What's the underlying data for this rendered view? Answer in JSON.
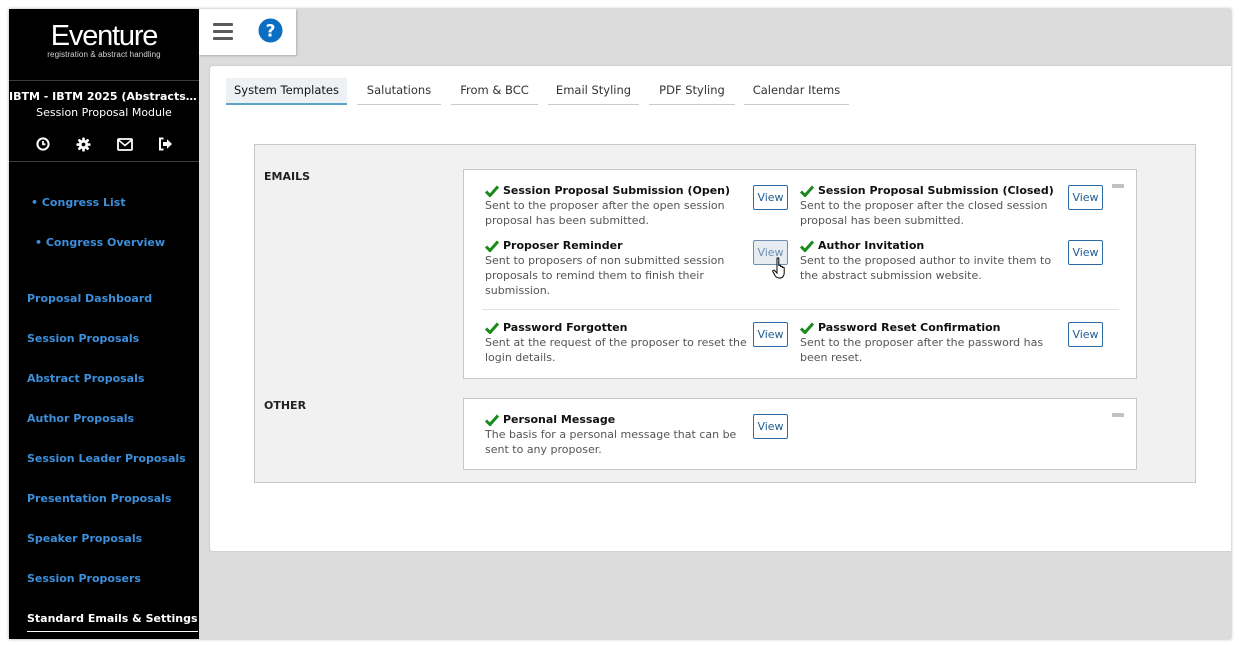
{
  "app": {
    "logo_name": "Eventure",
    "logo_tagline": "registration & abstract handling"
  },
  "event": {
    "title": "IBTM - IBTM 2025 (Abstracts & Par...",
    "module": "Session Proposal Module"
  },
  "sidebar": {
    "icons": [
      "clock-icon",
      "gear-icon",
      "envelope-icon",
      "sign-out-icon"
    ],
    "sub_items": [
      {
        "label": "• Congress List"
      },
      {
        "label": "• Congress Overview"
      }
    ],
    "items": [
      {
        "label": "Proposal Dashboard"
      },
      {
        "label": "Session Proposals"
      },
      {
        "label": "Abstract Proposals"
      },
      {
        "label": "Author Proposals"
      },
      {
        "label": "Session Leader Proposals"
      },
      {
        "label": "Presentation Proposals"
      },
      {
        "label": "Speaker Proposals"
      },
      {
        "label": "Session Proposers"
      },
      {
        "label": "Standard Emails & Settings",
        "active": true
      }
    ]
  },
  "tabs": [
    {
      "label": "System Templates",
      "active": true
    },
    {
      "label": "Salutations"
    },
    {
      "label": "From & BCC"
    },
    {
      "label": "Email Styling"
    },
    {
      "label": "PDF Styling"
    },
    {
      "label": "Calendar Items"
    }
  ],
  "sections": {
    "emails": {
      "label": "EMAILS",
      "templates": [
        {
          "title": "Session Proposal Submission (Open)",
          "desc": "Sent to the proposer after the open session proposal has been submitted."
        },
        {
          "title": "Session Proposal Submission (Closed)",
          "desc": "Sent to the proposer after the closed session proposal has been submitted."
        },
        {
          "title": "Proposer Reminder",
          "desc": "Sent to proposers of non submitted session proposals to remind them to finish their submission."
        },
        {
          "title": "Author Invitation",
          "desc": "Sent to the proposed author to invite them to the abstract submission website."
        },
        {
          "title": "Password Forgotten",
          "desc": "Sent at the request of the proposer to reset the login details."
        },
        {
          "title": "Password Reset Confirmation",
          "desc": "Sent to the proposer after the password has been reset."
        }
      ]
    },
    "other": {
      "label": "OTHER",
      "templates": [
        {
          "title": "Personal Message",
          "desc": "The basis for a personal message that can be sent to any proposer."
        }
      ]
    }
  },
  "buttons": {
    "view_label": "View"
  },
  "colors": {
    "sidebar_bg": "#000000",
    "link_blue": "#3d8fdb",
    "check_green": "#1a8a1a",
    "help_blue": "#0a6fc2",
    "tab_active_underline": "#5ea4c9"
  }
}
